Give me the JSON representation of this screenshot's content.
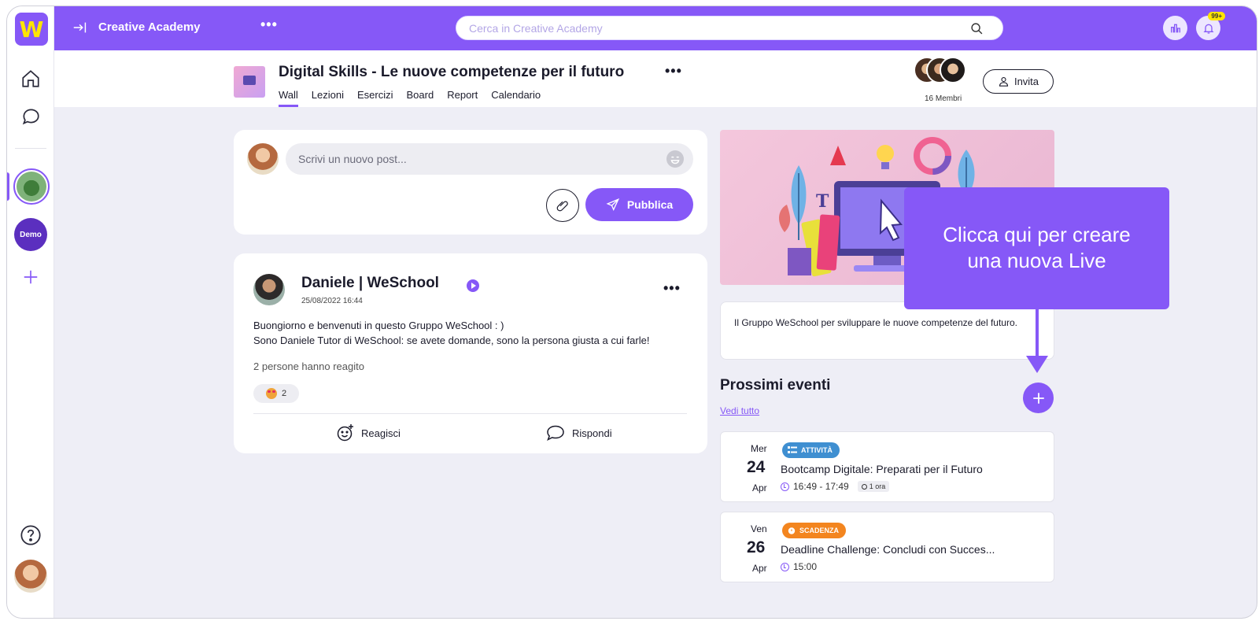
{
  "app": {
    "logo_letter": "W",
    "brand_color": "#8658f7"
  },
  "topbar": {
    "academy_title": "Creative Academy",
    "search_placeholder": "Cerca in Creative Academy",
    "notification_badge": "99+"
  },
  "rail": {
    "demo_label": "Demo"
  },
  "group": {
    "title": "Digital Skills - Le nuove competenze per il futuro",
    "tabs": [
      {
        "label": "Wall",
        "active": true
      },
      {
        "label": "Lezioni"
      },
      {
        "label": "Esercizi"
      },
      {
        "label": "Board"
      },
      {
        "label": "Report"
      },
      {
        "label": "Calendario"
      }
    ],
    "members_label": "16 Membri",
    "invite_label": "Invita"
  },
  "composer": {
    "placeholder": "Scrivi un nuovo post...",
    "publish_label": "Pubblica"
  },
  "post": {
    "author": "Daniele | WeSchool",
    "date": "25/08/2022 16:44",
    "body_line1": "Buongiorno e benvenuti in questo Gruppo WeSchool : )",
    "body_line2": "Sono Daniele Tutor di WeSchool: se avete domande, sono la persona giusta a cui farle!",
    "reactions_label": "2 persone hanno reagito",
    "reaction_count": "2",
    "react_label": "Reagisci",
    "reply_label": "Rispondi"
  },
  "sidebar_right": {
    "description": "Il Gruppo WeSchool per sviluppare le nuove competenze del futuro.",
    "events_title": "Prossimi eventi",
    "see_all": "Vedi tutto",
    "events": [
      {
        "dow": "Mer",
        "day": "24",
        "month": "Apr",
        "badge": "ATTIVITÀ",
        "badge_color": "#3f8fd1",
        "title": "Bootcamp Digitale: Preparati per il Futuro",
        "time": "16:49 - 17:49",
        "duration": "1 ora"
      },
      {
        "dow": "Ven",
        "day": "26",
        "month": "Apr",
        "badge": "SCADENZA",
        "badge_color": "#f3851f",
        "title": "Deadline Challenge: Concludi con Succes...",
        "time": "15:00"
      }
    ]
  },
  "callout": {
    "line1": "Clicca qui per creare",
    "line2": "una nuova Live"
  }
}
